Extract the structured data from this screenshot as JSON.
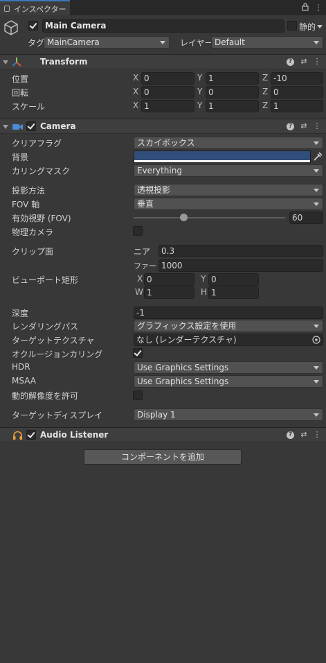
{
  "tab": {
    "title": "インスペクター"
  },
  "gameobject": {
    "name": "Main Camera",
    "static_label": "静的",
    "tag_label": "タグ",
    "tag_value": "MainCamera",
    "layer_label": "レイヤー",
    "layer_value": "Default"
  },
  "transform": {
    "title": "Transform",
    "position_label": "位置",
    "rotation_label": "回転",
    "scale_label": "スケール",
    "axis_x": "X",
    "axis_y": "Y",
    "axis_z": "Z",
    "position": {
      "x": "0",
      "y": "1",
      "z": "-10"
    },
    "rotation": {
      "x": "0",
      "y": "0",
      "z": "0"
    },
    "scale": {
      "x": "1",
      "y": "1",
      "z": "1"
    }
  },
  "camera": {
    "title": "Camera",
    "clear_flags_label": "クリアフラグ",
    "clear_flags_value": "スカイボックス",
    "background_label": "背景",
    "background_color": "#314d79",
    "culling_mask_label": "カリングマスク",
    "culling_mask_value": "Everything",
    "projection_label": "投影方法",
    "projection_value": "透視投影",
    "fov_axis_label": "FOV 軸",
    "fov_axis_value": "垂直",
    "fov_label": "有効視野 (FOV)",
    "fov_value": "60",
    "fov_fraction": 0.333,
    "physical_camera_label": "物理カメラ",
    "clipping_label": "クリップ面",
    "near_label": "ニア",
    "near_value": "0.3",
    "far_label": "ファー",
    "far_value": "1000",
    "viewport_label": "ビューポート矩形",
    "vp_x_label": "X",
    "vp_x_value": "0",
    "vp_y_label": "Y",
    "vp_y_value": "0",
    "vp_w_label": "W",
    "vp_w_value": "1",
    "vp_h_label": "H",
    "vp_h_value": "1",
    "depth_label": "深度",
    "depth_value": "-1",
    "rendering_path_label": "レンダリングパス",
    "rendering_path_value": "グラフィックス設定を使用",
    "target_texture_label": "ターゲットテクスチャ",
    "target_texture_value": "なし (レンダーテクスチャ)",
    "occlusion_label": "オクルージョンカリング",
    "hdr_label": "HDR",
    "hdr_value": "Use Graphics Settings",
    "msaa_label": "MSAA",
    "msaa_value": "Use Graphics Settings",
    "dynamic_res_label": "動的解像度を許可",
    "target_display_label": "ターゲットディスプレイ",
    "target_display_value": "Display 1"
  },
  "audio_listener": {
    "title": "Audio Listener"
  },
  "add_component": {
    "label": "コンポーネントを追加"
  },
  "icons": {
    "help": "?",
    "settings": "⇄",
    "more": "⋮"
  }
}
